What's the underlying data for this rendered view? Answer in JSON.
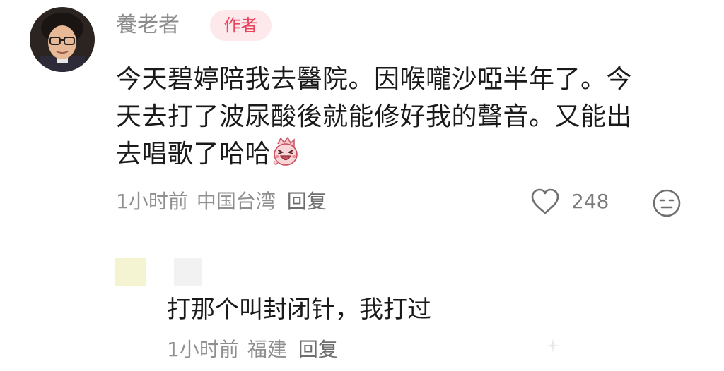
{
  "comment": {
    "username": "養老者",
    "badge": "作者",
    "text_lines": [
      "今天碧婷陪我去醫院。因喉嚨沙啞半年了。今",
      "天去打了波尿酸後就能修好我的聲音。又能出",
      "去唱歌了哈哈"
    ],
    "emoji": "laughing-sticker",
    "time": "1小时前",
    "location": "中国台湾",
    "reply_label": "回复",
    "likes": "248"
  },
  "reply": {
    "text": "打那个叫封闭针，我打过",
    "time": "1小时前",
    "location": "福建",
    "reply_label": "回复"
  },
  "colors": {
    "badge_bg": "#fde8ec",
    "badge_text": "#e8445c",
    "meta_text": "#8f8f8f"
  },
  "icons": [
    "heart-icon",
    "neutral-face-icon",
    "sparkle-icon"
  ]
}
